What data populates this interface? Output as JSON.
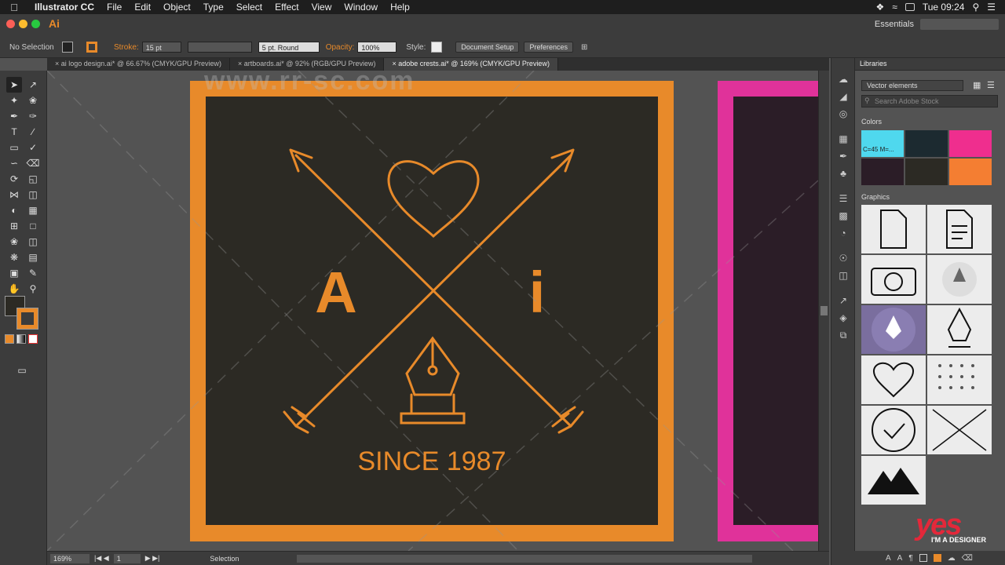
{
  "menubar": {
    "app": "Illustrator CC",
    "items": [
      "File",
      "Edit",
      "Object",
      "Type",
      "Select",
      "Effect",
      "View",
      "Window",
      "Help"
    ],
    "clock": "Tue 09:24"
  },
  "control": {
    "selection": "No Selection",
    "stroke_label": "Stroke:",
    "stroke_value": "15 pt",
    "brush_value": "5 pt. Round",
    "opacity_label": "Opacity:",
    "opacity_value": "100%",
    "style_label": "Style:",
    "doc_setup": "Document Setup",
    "preferences": "Preferences",
    "workspace": "Essentials"
  },
  "tabs": [
    {
      "label": "ai logo design.ai* @ 66.67% (CMYK/GPU Preview)"
    },
    {
      "label": "artboards.ai* @ 92% (RGB/GPU Preview)"
    },
    {
      "label": "adobe crests.ai* @ 169% (CMYK/GPU Preview)"
    }
  ],
  "artwork": {
    "letter_left": "A",
    "letter_right": "i",
    "since": "SINCE 1987",
    "accent": "#e88a2a",
    "bg": "#2c2a24",
    "pink": "#e0329a"
  },
  "libraries": {
    "title": "Libraries",
    "library": "Vector elements",
    "search_placeholder": "Search Adobe Stock",
    "colors_label": "Colors",
    "colors": [
      "#4fd8ee",
      "#1c2a30",
      "#ef2e8e",
      "#2b1d27",
      "#2c2a24",
      "#f47e32"
    ],
    "color_tooltip": "C=45 M=...",
    "graphics_label": "Graphics",
    "graphics": [
      "document-icon",
      "document-lines-icon",
      "camera-icon",
      "pen-drop-icon",
      "pen-circle-icon",
      "pen-nib-icon",
      "heart-icon",
      "pattern-icon",
      "check-circle-icon",
      "cross-arrows-icon",
      "mountain-icon"
    ]
  },
  "status": {
    "zoom": "169%",
    "artboard": "1",
    "mode": "Selection"
  },
  "branding": {
    "yes": "yes",
    "tagline": "I'M A DESIGNER",
    "watermark": "www.rr-sc.com"
  }
}
